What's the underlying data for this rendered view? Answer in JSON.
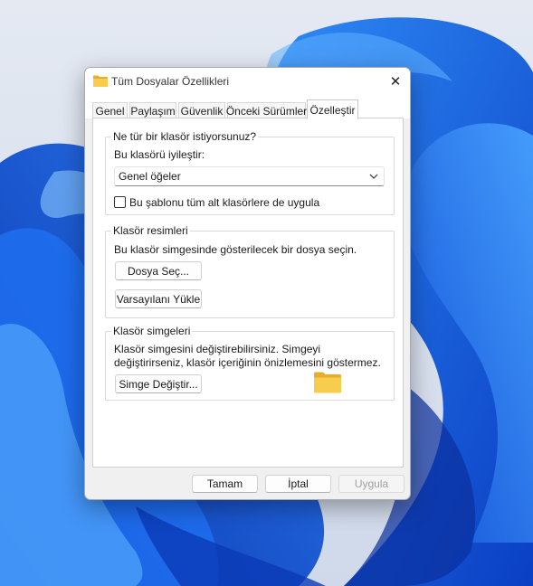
{
  "window": {
    "title": "Tüm Dosyalar Özellikleri",
    "close_label": "✕"
  },
  "tabs": [
    {
      "label": "Genel"
    },
    {
      "label": "Paylaşım"
    },
    {
      "label": "Güvenlik"
    },
    {
      "label": "Önceki Sürümler"
    },
    {
      "label": "Özelleştir",
      "active": true
    }
  ],
  "optimize_group": {
    "title": "Ne tür bir klasör istiyorsunuz?",
    "label": "Bu klasörü iyileştir:",
    "selected_value": "Genel öğeler",
    "checkbox_label": "Bu şablonu tüm alt klasörlere de uygula",
    "checkbox_checked": false
  },
  "pictures_group": {
    "title": "Klasör resimleri",
    "description": "Bu klasör simgesinde gösterilecek bir dosya seçin.",
    "choose_file_label": "Dosya Seç...",
    "restore_default_label": "Varsayılanı Yükle"
  },
  "icons_group": {
    "title": "Klasör simgeleri",
    "description": "Klasör simgesini değiştirebilirsiniz. Simgeyi değiştirirseniz, klasör içeriğinin önizlemesini göstermez.",
    "change_icon_label": "Simge Değiştir..."
  },
  "footer": {
    "ok_label": "Tamam",
    "cancel_label": "İptal",
    "apply_label": "Uygula",
    "apply_enabled": false
  },
  "icons": [
    "folder-icon",
    "close-icon",
    "chevron-down-icon"
  ],
  "colors": {
    "folder_yellow": "#f8cc4e",
    "wallpaper_blue": "#1a66e0",
    "dialog_bg": "#f0f0f0"
  }
}
